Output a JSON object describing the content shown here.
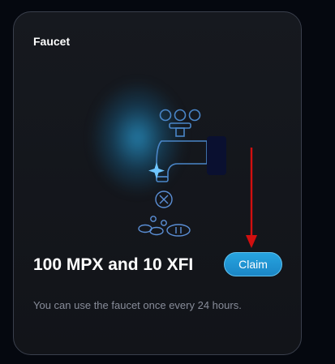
{
  "faucet": {
    "title": "Faucet",
    "amount_text": "100 MPX and 10 XFI",
    "claim_label": "Claim",
    "note": "You can use the faucet once every 24 hours."
  },
  "colors": {
    "accent": "#1f95d3",
    "annotation_arrow": "#d10f0f",
    "card_background": "#15181e",
    "card_border": "#3a3f4c"
  },
  "icons": [
    "faucet-tap-icon",
    "sparkle-icon",
    "coin-icon"
  ]
}
